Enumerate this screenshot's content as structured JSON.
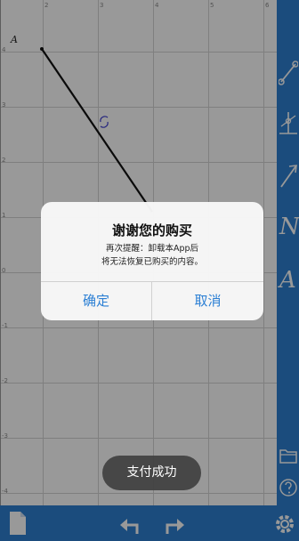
{
  "canvas": {
    "point_label": "A",
    "ticks_top": [
      "2",
      "3",
      "4",
      "5",
      "6"
    ],
    "ticks_left": [
      "4",
      "3",
      "2",
      "1",
      "0",
      "-1",
      "-2",
      "-3",
      "-4"
    ]
  },
  "toolbar": {
    "tools": [
      {
        "name": "segment-tool",
        "icon": "segment-icon"
      },
      {
        "name": "perpendicular-tool",
        "icon": "perpendicular-icon"
      },
      {
        "name": "ray-tool",
        "icon": "ray-icon"
      },
      {
        "name": "text-tool-n",
        "letter": "N"
      },
      {
        "name": "text-tool-a",
        "letter": "A"
      },
      {
        "name": "folder-tool",
        "icon": "folder-icon"
      },
      {
        "name": "help-tool",
        "icon": "help-icon"
      }
    ]
  },
  "bottombar": {
    "items": [
      "document-icon",
      "undo-icon",
      "redo-icon",
      "settings-icon"
    ]
  },
  "dialog": {
    "title": "谢谢您的购买",
    "message_line1": "再次提醒：卸载本App后",
    "message_line2": "将无法恢复已购买的内容。",
    "confirm_label": "确定",
    "cancel_label": "取消"
  },
  "toast": {
    "text": "支付成功"
  },
  "colors": {
    "accent": "#2e7fd0",
    "dialog_button": "#2b7fd4"
  }
}
